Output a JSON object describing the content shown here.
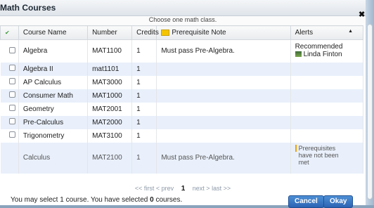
{
  "dialog": {
    "title": "Math Courses",
    "instruction": "Choose one math class."
  },
  "columns": {
    "name": "Course Name",
    "number": "Number",
    "credits": "Credits",
    "prereq": "Prerequisite Note",
    "alerts": "Alerts",
    "sort_arrow": "▲"
  },
  "rows": [
    {
      "name": "Algebra",
      "number": "MAT1100",
      "credits": "1",
      "prereq": "Must pass Pre-Algebra.",
      "alert_label": "Recommended",
      "alert_person": "Linda Finton"
    },
    {
      "name": "Algebra II",
      "number": "mat1101",
      "credits": "1",
      "prereq": ""
    },
    {
      "name": "AP Calculus",
      "number": "MAT3000",
      "credits": "1",
      "prereq": ""
    },
    {
      "name": "Consumer Math",
      "number": "MAT1000",
      "credits": "1",
      "prereq": ""
    },
    {
      "name": "Geometry",
      "number": "MAT2001",
      "credits": "1",
      "prereq": ""
    },
    {
      "name": "Pre-Calculus",
      "number": "MAT2000",
      "credits": "1",
      "prereq": ""
    },
    {
      "name": "Trigonometry",
      "number": "MAT3100",
      "credits": "1",
      "prereq": ""
    },
    {
      "name": "Calculus",
      "number": "MAT2100",
      "credits": "1",
      "prereq": "Must pass Pre-Algebra.",
      "alert_warning": "Prerequisites have not been met"
    }
  ],
  "pager": {
    "first": "<< first",
    "prev": "< prev",
    "current": "1",
    "next": "next >",
    "last": "last >>"
  },
  "footer": {
    "prefix": "You may select 1 course. You have selected ",
    "count": "0",
    "suffix": " courses."
  },
  "buttons": {
    "cancel": "Cancel",
    "okay": "Okay"
  },
  "colors": {
    "accent": "#2a63b3",
    "row_alt": "#e9f0fb",
    "warning": "#f1a200"
  }
}
